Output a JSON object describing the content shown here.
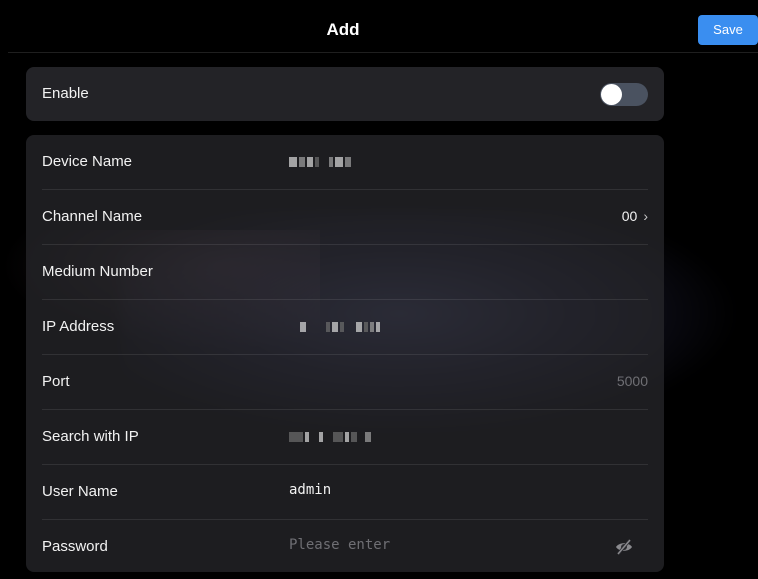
{
  "header": {
    "title": "Add",
    "save_label": "Save"
  },
  "enable": {
    "label": "Enable",
    "state": "off"
  },
  "form": {
    "device_name": {
      "label": "Device Name"
    },
    "channel_name": {
      "label": "Channel Name",
      "value": "00"
    },
    "medium_number": {
      "label": "Medium Number"
    },
    "ip_address": {
      "label": "IP Address"
    },
    "port": {
      "label": "Port",
      "placeholder": "5000"
    },
    "search_with_ip": {
      "label": "Search with IP"
    },
    "user_name": {
      "label": "User Name",
      "value": "admin"
    },
    "password": {
      "label": "Password",
      "placeholder": "Please enter"
    }
  },
  "icons": {
    "chevron": "chevron-right-icon",
    "eye": "eye-off-icon"
  },
  "colors": {
    "accent": "#3a8ef0",
    "background": "#000000",
    "card": "#26262a",
    "toggle_off": "#4a5260"
  }
}
